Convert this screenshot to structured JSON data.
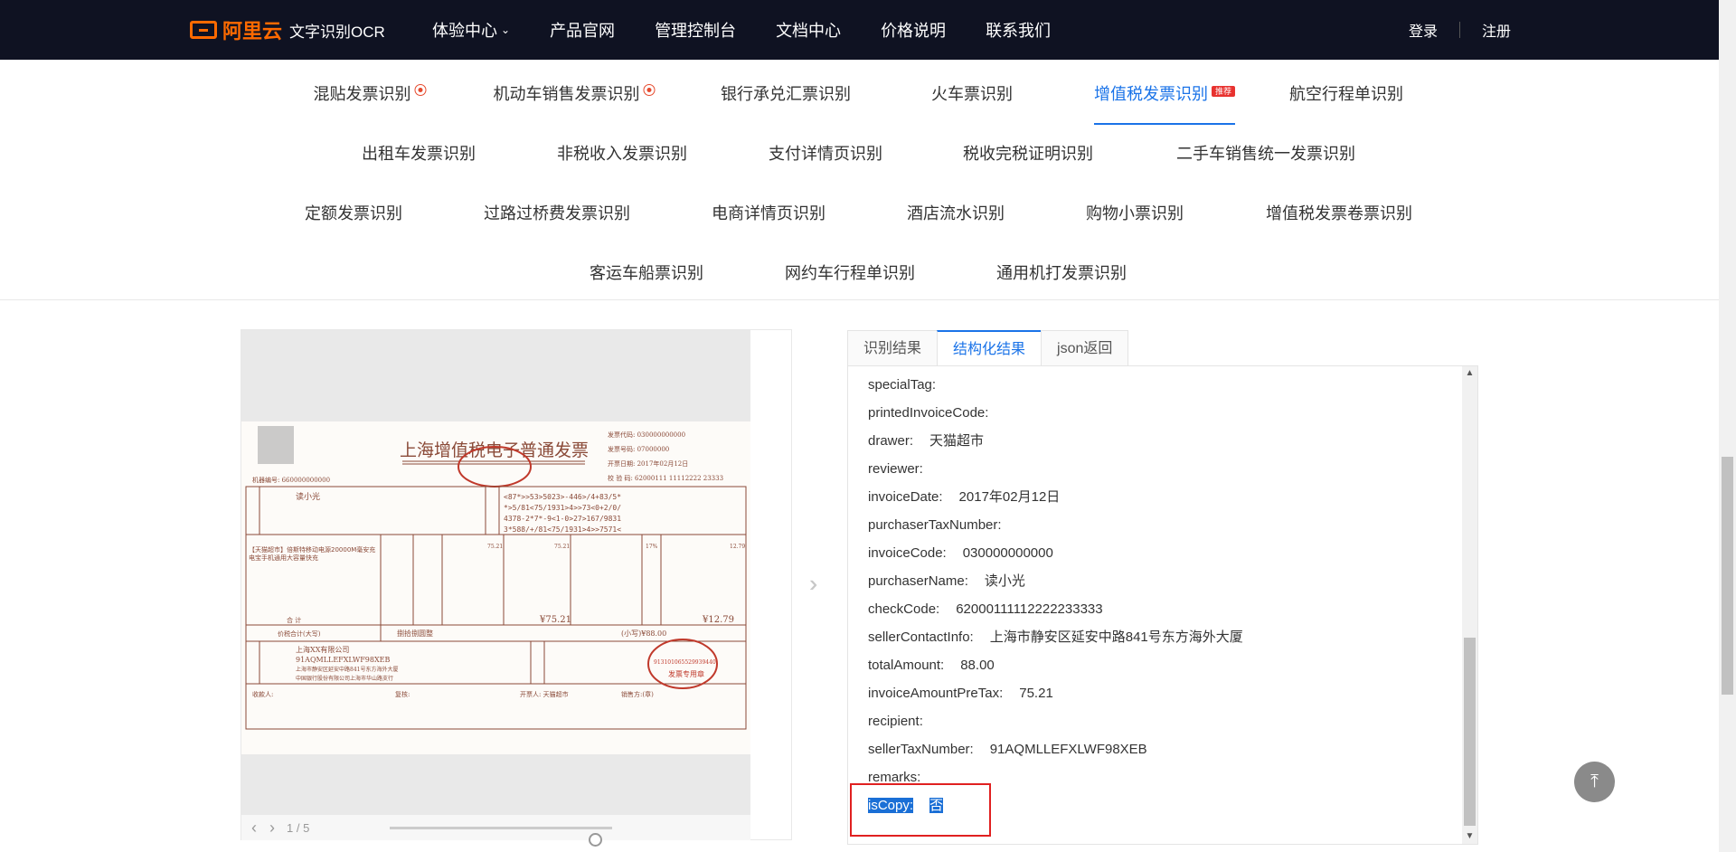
{
  "header": {
    "brand": "阿里云",
    "product": "文字识别OCR",
    "nav": [
      "体验中心",
      "产品官网",
      "管理控制台",
      "文档中心",
      "价格说明",
      "联系我们"
    ],
    "login": "登录",
    "register": "注册"
  },
  "categories": {
    "row1": [
      "混贴发票识别",
      "机动车销售发票识别",
      "银行承兑汇票识别",
      "火车票识别",
      "增值税发票识别",
      "航空行程单识别"
    ],
    "row2": [
      "出租车发票识别",
      "非税收入发票识别",
      "支付详情页识别",
      "税收完税证明识别",
      "二手车销售统一发票识别"
    ],
    "row3": [
      "定额发票识别",
      "过路过桥费发票识别",
      "电商详情页识别",
      "酒店流水识别",
      "购物小票识别",
      "增值税发票卷票识别"
    ],
    "row4": [
      "客运车船票识别",
      "网约车行程单识别",
      "通用机打发票识别"
    ],
    "hot_badge": "HOT",
    "recommend_badge": "推荐"
  },
  "preview": {
    "page_indicator": "1 / 5",
    "zoom_level": 0.23,
    "invoice": {
      "title": "上海增值税电子普通发票",
      "code_label": "发票代码:",
      "code": "030000000000",
      "number_label": "发票号码:",
      "number": "07000000",
      "date_label": "开票日期:",
      "date": "2017年02月12日",
      "check_label": "校 验 码:",
      "check": "62000111 11112222 23333",
      "machine_label": "机器编号:",
      "machine": "660000000000",
      "buyer_name": "读小光",
      "cipher": [
        "<87*>>53>5023>-446>/4+83/5*",
        "*>5/81<75/1931>4>>73<0+2/0/",
        "4378-2*7*-9<1-0>27>167/9831",
        "3*588/+/81<75/1931>4>>7571<"
      ],
      "item": "【天猫超市】倍斯特移动电源20000M毫安充电宝手机通用大容量快充",
      "amount": "75.21",
      "tax_rate": "17%",
      "tax": "12.79",
      "sum_label": "合  计",
      "sum_amount": "¥75.21",
      "sum_tax": "¥12.79",
      "total_label": "价税合计(大写)",
      "total_cn": "捌拾捌圆整",
      "total_small": "(小写)¥88.00",
      "seller_name": "上海XX有限公司",
      "seller_tax": "91AQMLLEFXLWF98XEB",
      "seller_addr": "上海市静安区延安中路841号东方海外大厦",
      "seller_bank": "中国银行股份有限公司上海市华山路支行",
      "seal_number": "913101065529939440",
      "seal_text": "发票专用章",
      "payee_label": "收款人:",
      "reviewer_label": "复核:",
      "drawer_label": "开票人:",
      "drawer": "天猫超市",
      "sales_label": "销售方:(章)"
    }
  },
  "tabs": [
    "识别结果",
    "结构化结果",
    "json返回"
  ],
  "result": [
    {
      "key": "specialTag:",
      "value": ""
    },
    {
      "key": "printedInvoiceCode:",
      "value": ""
    },
    {
      "key": "drawer:",
      "value": "天猫超市"
    },
    {
      "key": "reviewer:",
      "value": ""
    },
    {
      "key": "invoiceDate:",
      "value": "2017年02月12日"
    },
    {
      "key": "purchaserTaxNumber:",
      "value": ""
    },
    {
      "key": "invoiceCode:",
      "value": "030000000000"
    },
    {
      "key": "purchaserName:",
      "value": "读小光"
    },
    {
      "key": "checkCode:",
      "value": "62000111112222233333"
    },
    {
      "key": "sellerContactInfo:",
      "value": "上海市静安区延安中路841号东方海外大厦"
    },
    {
      "key": "totalAmount:",
      "value": "88.00"
    },
    {
      "key": "invoiceAmountPreTax:",
      "value": "75.21"
    },
    {
      "key": "recipient:",
      "value": ""
    },
    {
      "key": "sellerTaxNumber:",
      "value": "91AQMLLEFXLWF98XEB"
    },
    {
      "key": "remarks:",
      "value": ""
    },
    {
      "key": "isCopy:",
      "value": "否"
    }
  ],
  "colors": {
    "accent": "#1a73e8",
    "brand": "#ff6a00",
    "nav_bg": "#0f1222",
    "highlight": "#e02020"
  }
}
